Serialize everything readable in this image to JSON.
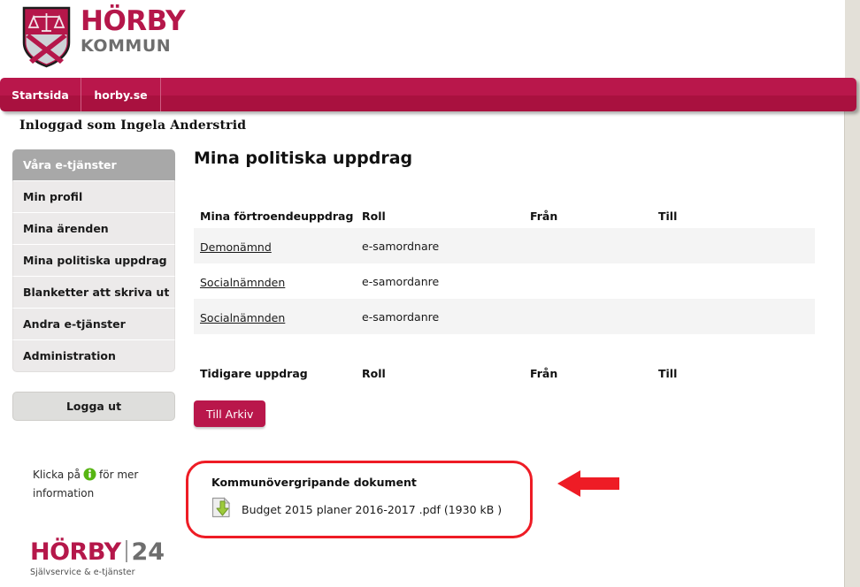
{
  "brand": {
    "logo_primary": "HÖRBY",
    "logo_secondary": "KOMMUN",
    "logo_icon": "shield-scales-cross-icon",
    "accent_color": "#b5174a",
    "nav_color": "#b9174b",
    "annotation_color": "#ee1c25"
  },
  "nav": {
    "items": [
      {
        "label": "Startsida"
      },
      {
        "label": "horby.se"
      }
    ]
  },
  "session": {
    "logged_in_text": "Inloggad som Ingela Anderstrid"
  },
  "sidebar": {
    "items": [
      {
        "label": "Våra e-tjänster",
        "active": true
      },
      {
        "label": "Min profil",
        "active": false
      },
      {
        "label": "Mina ärenden",
        "active": false
      },
      {
        "label": "Mina politiska uppdrag",
        "active": false
      },
      {
        "label": "Blanketter att skriva ut",
        "active": false
      },
      {
        "label": "Andra e-tjänster",
        "active": false
      },
      {
        "label": "Administration",
        "active": false
      }
    ],
    "logout_label": "Logga ut",
    "info_hint_before": "Klicka på",
    "info_hint_after": "för mer information",
    "info_icon": "info-circle-icon"
  },
  "footer": {
    "logo_primary": "HÖRBY",
    "logo_secondary": "24",
    "tagline": "Självservice & e-tjänster"
  },
  "main": {
    "page_title": "Mina politiska uppdrag",
    "current_table": {
      "headers": [
        "Mina förtroendeuppdrag",
        "Roll",
        "Från",
        "Till"
      ],
      "rows": [
        {
          "uppdrag": "Demonämnd",
          "roll": "e-samordnare",
          "fran": "",
          "till": ""
        },
        {
          "uppdrag": "Socialnämnden",
          "roll": "e-samordanre",
          "fran": "",
          "till": ""
        },
        {
          "uppdrag": "Socialnämnden",
          "roll": "e-samordanre",
          "fran": "",
          "till": ""
        }
      ]
    },
    "previous_table": {
      "headers": [
        "Tidigare uppdrag",
        "Roll",
        "Från",
        "Till"
      ],
      "rows": []
    },
    "archive_button_label": "Till Arkiv"
  },
  "documents": {
    "section_title": "Kommunövergripande dokument",
    "download_icon": "download-document-icon",
    "files": [
      {
        "name": "Budget 2015 planer 2016-2017 .pdf (1930 kB )"
      }
    ]
  },
  "annotation": {
    "arrow_icon": "left-arrow-annotation-icon"
  }
}
